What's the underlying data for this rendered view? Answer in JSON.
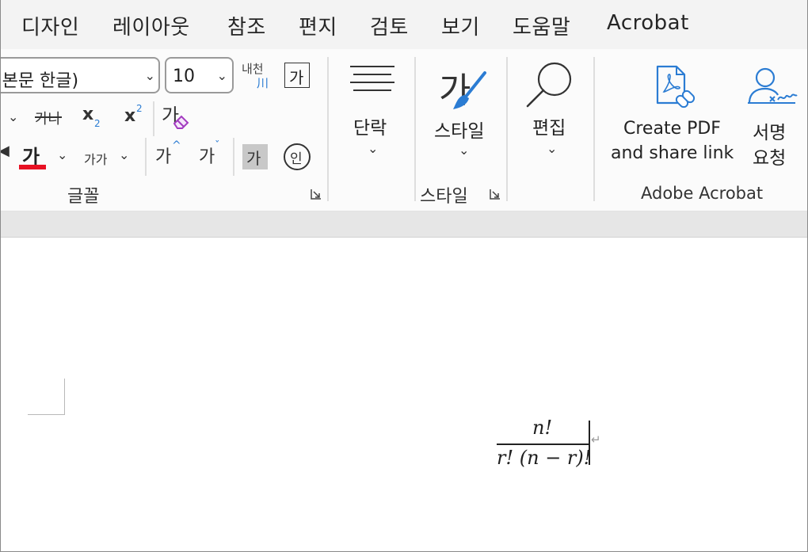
{
  "menu": {
    "tabs": [
      "디자인",
      "레이아웃",
      "참조",
      "편지",
      "검토",
      "보기",
      "도움말",
      "Acrobat"
    ]
  },
  "ribbon": {
    "font": {
      "name_value": "(본문 한글)",
      "size_value": "10",
      "phonetic_top": "내천",
      "phonetic_bottom": "川",
      "char_border": "가",
      "strike_label": "가나",
      "sub_label": "x",
      "sub_num": "2",
      "sup_label": "x",
      "sup_num": "2",
      "clear_label": "가",
      "font_color_label": "가",
      "change_case_label": "가가",
      "grow_label": "가",
      "shrink_label": "가",
      "char_shading_label": "가",
      "enclose_label": "인",
      "group_label": "글꼴"
    },
    "paragraph": {
      "label": "단락"
    },
    "styles": {
      "label": "스타일",
      "group_label": "스타일",
      "big_glyph": "가"
    },
    "editing": {
      "label": "편집"
    },
    "acrobat": {
      "create_line1": "Create PDF",
      "create_line2": "and share link",
      "sign_line1": "서명",
      "sign_line2": "요청",
      "group_label": "Adobe Acrobat"
    },
    "colors": {
      "font_color_bar": "#e81123",
      "accent": "#2b7cd3"
    }
  },
  "document": {
    "equation": {
      "numerator": "n!",
      "denominator": "r! (n − r)!"
    }
  }
}
